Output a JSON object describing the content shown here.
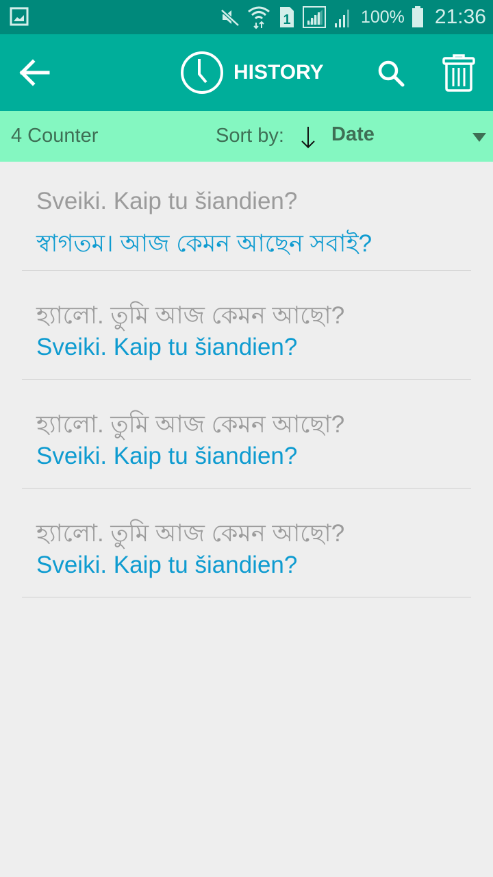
{
  "status_bar": {
    "icons": [
      "gallery-icon",
      "mute-icon",
      "wifi-icon",
      "sim1-icon",
      "signal-icon",
      "signal-icon-2",
      "battery-icon"
    ],
    "battery_percent": "100%",
    "time": "21:36"
  },
  "app_bar": {
    "back_icon": "arrow-left-icon",
    "title_icon": "clock-icon",
    "title": "HISTORY",
    "search_icon": "search-icon",
    "delete_icon": "trash-icon"
  },
  "sort_bar": {
    "counter": "4 Counter",
    "sort_label": "Sort by:",
    "sort_direction_icon": "arrow-down-icon",
    "sort_value": "Date"
  },
  "history": [
    {
      "source": "Sveiki. Kaip tu šiandien?",
      "translation": "স্বাগতম। আজ কেমন আছেন সবাই?"
    },
    {
      "source": "হ্যালো. তুমি আজ কেমন আছো?",
      "translation": "Sveiki. Kaip tu šiandien?"
    },
    {
      "source": "হ্যালো. তুমি আজ কেমন আছো?",
      "translation": "Sveiki. Kaip tu šiandien?"
    },
    {
      "source": "হ্যালো. তুমি আজ কেমন আছো?",
      "translation": "Sveiki. Kaip tu šiandien?"
    }
  ],
  "colors": {
    "status_bar": "#00897b",
    "app_bar": "#00ae9a",
    "sort_bar": "#84f7c1",
    "source_text": "#9b9b9b",
    "translation_text": "#0e9bd0",
    "background": "#eeeeee"
  }
}
